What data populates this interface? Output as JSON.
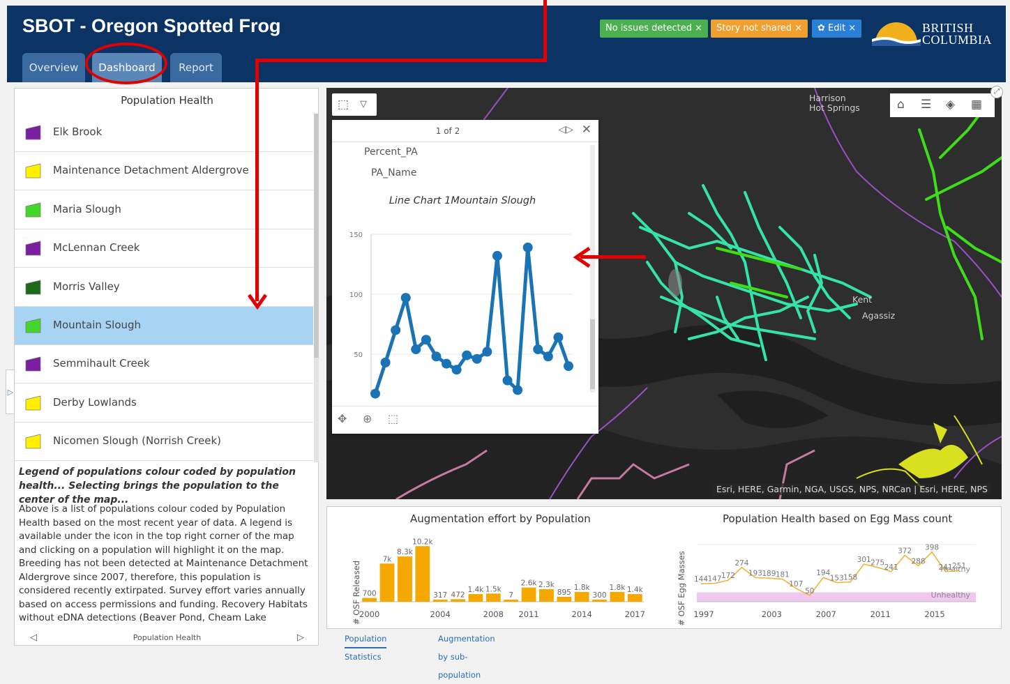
{
  "app": {
    "title": "SBOT - Oregon Spotted Frog"
  },
  "tabs": [
    {
      "label": "Overview"
    },
    {
      "label": "Dashboard"
    },
    {
      "label": "Report"
    }
  ],
  "badges": {
    "issues": {
      "label": "No issues detected",
      "color": "#4caf50"
    },
    "story": {
      "label": "Story not shared",
      "color": "#f0a030"
    },
    "edit": {
      "label": "Edit",
      "color": "#2a7fd4"
    }
  },
  "brand": {
    "line1": "BRITISH",
    "line2": "COLUMBIA"
  },
  "left_panel": {
    "title": "Population Health",
    "populations": [
      {
        "label": "Elk Brook",
        "color": "#7b1fa2"
      },
      {
        "label": "Maintenance Detachment Aldergrove",
        "color": "#fff000"
      },
      {
        "label": "Maria Slough",
        "color": "#44d62c"
      },
      {
        "label": "McLennan Creek",
        "color": "#7b1fa2"
      },
      {
        "label": "Morris Valley",
        "color": "#1b6b1b"
      },
      {
        "label": "Mountain Slough",
        "color": "#44d62c",
        "selected": true
      },
      {
        "label": "Semmihault Creek",
        "color": "#7b1fa2"
      },
      {
        "label": "Derby Lowlands",
        "color": "#fff000"
      },
      {
        "label": "Nicomen Slough (Norrish Creek)",
        "color": "#fff000"
      }
    ],
    "legend_note": "Legend of populations colour coded by population health... Selecting brings the population to the center of the map...",
    "description": "Above is a list of populations colour coded by Population Health based on the most recent year of data. A legend is available under the icon in the top right corner of the map and clicking on a population will highlight it on the map. Breeding has not been detected at Maintenance Detachment Aldergrove since 2007, therefore, this population is considered recently extirpated. Survey effort varies annually based on access permissions and funding. Recovery Habitats without eDNA detections (Beaver Pond, Cheam Lake Wetlands, and Smith Falls Creek Wetland)",
    "footer": "Population Health"
  },
  "map": {
    "places": {
      "harrison": "Harrison\nHot Springs",
      "kent": "Kent",
      "agassiz": "Agassiz"
    },
    "attribution": "Esri, HERE, Garmin, NGA, USGS, NPS, NRCan | Esri, HERE, NPS"
  },
  "popup": {
    "count": "1 of 2",
    "fields": [
      "Percent_PA",
      "PA_Name"
    ],
    "chart_title": "Line Chart 1Mountain Slough"
  },
  "chart_data": [
    {
      "type": "line",
      "title": "Line Chart 1Mountain Slough",
      "y_ticks": [
        50,
        100,
        150
      ],
      "ylim": [
        15,
        150
      ],
      "values": [
        17,
        43,
        70,
        97,
        54,
        62,
        48,
        42,
        37,
        49,
        46,
        52,
        132,
        28,
        20,
        139,
        54,
        48,
        64,
        40
      ],
      "color": "#1a73b5"
    },
    {
      "type": "bar",
      "title": "Augmentation effort by Population",
      "ylabel": "# OSF Released",
      "x_ticks": [
        "2000",
        "2004",
        "2008",
        "2011",
        "2014",
        "2017"
      ],
      "values": [
        700,
        7000,
        8300,
        10200,
        317,
        472,
        1400,
        1500,
        7,
        2600,
        2300,
        895,
        1800,
        300,
        1800,
        1400
      ],
      "labels": [
        "700",
        "7k",
        "8.3k",
        "10.2k",
        "317",
        "472",
        "1.4k",
        "1.5k",
        "7",
        "2.6k",
        "2.3k",
        "895",
        "1.8k",
        "300",
        "1.8k",
        "1.4k"
      ],
      "color": "#f5a800"
    },
    {
      "type": "line",
      "title": "Population Health based on Egg Mass count",
      "ylabel": "# OSF Egg Masses",
      "x_ticks": [
        "1997",
        "2003",
        "2007",
        "2011",
        "2015"
      ],
      "values": [
        144,
        147,
        172,
        274,
        193,
        189,
        181,
        107,
        50,
        194,
        153,
        158,
        301,
        275,
        241,
        372,
        288,
        398,
        241,
        251
      ],
      "bands": {
        "healthy": "Healthy",
        "unhealthy": "Unhealthy"
      },
      "color": "#f0b030"
    }
  ],
  "bottom_tabs": [
    {
      "label": "Population Statistics"
    },
    {
      "label": "Augmentation by sub-population"
    }
  ]
}
